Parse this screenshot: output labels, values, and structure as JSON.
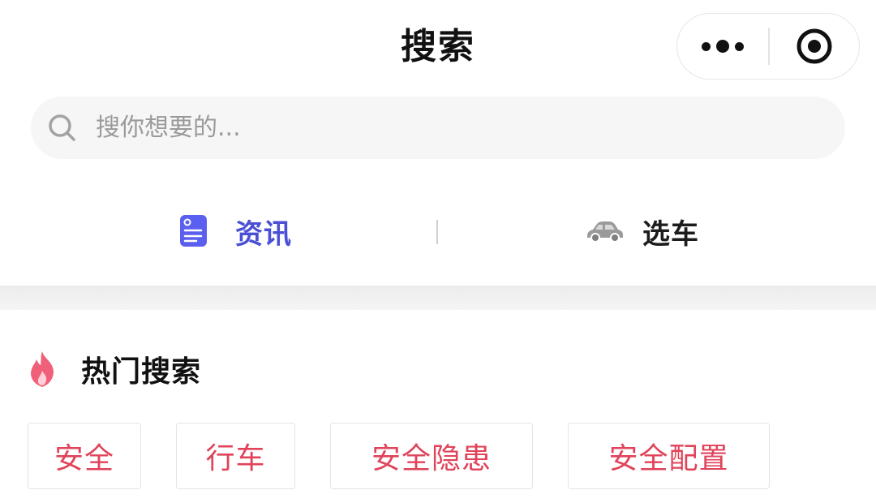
{
  "header": {
    "title": "搜索"
  },
  "capsule": {
    "more_icon": "more-dots-icon",
    "close_icon": "target-circle-icon"
  },
  "search": {
    "icon": "search-icon",
    "placeholder": "搜你想要的...",
    "value": ""
  },
  "tabs": [
    {
      "label": "资讯",
      "icon": "document-icon",
      "active": true,
      "color": "#4a4fd6"
    },
    {
      "label": "选车",
      "icon": "car-icon",
      "active": false,
      "color": "#1c1c1c"
    }
  ],
  "hot_search": {
    "icon": "flame-icon",
    "title": "热门搜索",
    "tag_color": "#e0435a",
    "tags": [
      "安全",
      "行车",
      "安全隐患",
      "安全配置"
    ]
  }
}
